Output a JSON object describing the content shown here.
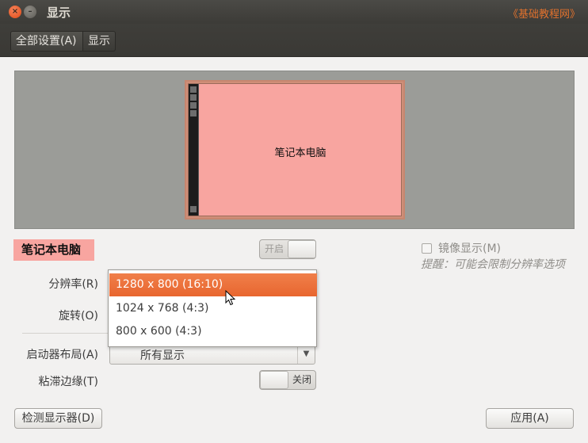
{
  "window": {
    "title": "显示",
    "watermark": "《基础教程网》",
    "close_glyph": "×",
    "minimize_glyph": "–"
  },
  "toolbar": {
    "all_settings": "全部设置(A)",
    "current": "显示"
  },
  "preview": {
    "monitor_label": "笔记本电脑"
  },
  "display": {
    "name": "笔记本电脑",
    "power_switch": {
      "label": "开启",
      "state": "on"
    },
    "mirror": {
      "label": "镜像显示(M)",
      "checked": false
    },
    "hint": "提醒：可能会限制分辨率选项"
  },
  "labels": {
    "resolution": "分辨率(R)",
    "rotation": "旋转(O)",
    "launcher_layout": "启动器布局(A)",
    "sticky_edges": "粘滞边缘(T)"
  },
  "resolution_dropdown": {
    "options": [
      {
        "label": "1280 x 800 (16:10)",
        "selected": true
      },
      {
        "label": "1024 x 768 (4:3)",
        "selected": false
      },
      {
        "label": "800 x 600 (4:3)",
        "selected": false
      }
    ]
  },
  "launcher_layout": {
    "value": "所有显示",
    "arrow": "▼"
  },
  "sticky_switch": {
    "label": "关闭",
    "state": "off"
  },
  "buttons": {
    "detect": "检测显示器(D)",
    "apply": "应用(A)"
  },
  "colors": {
    "accent": "#e8662f",
    "monitor_fill": "#f8a5a0",
    "preview_bg": "#9b9c98"
  }
}
